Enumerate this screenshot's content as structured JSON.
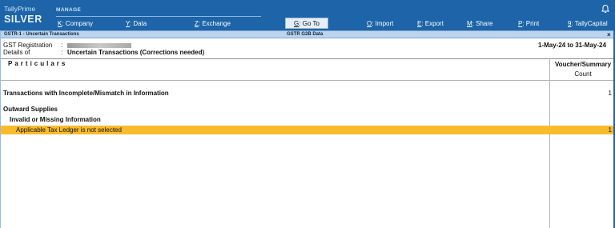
{
  "app": {
    "brand_line1": "TallyPrime",
    "brand_line2": "SILVER",
    "manage_label": "MANAGE"
  },
  "menu": [
    {
      "key": "K",
      "rest": ": Company"
    },
    {
      "key": "Y",
      "rest": ": Data"
    },
    {
      "key": "Z",
      "rest": ": Exchange"
    },
    {
      "key": "G",
      "rest": ": Go To"
    },
    {
      "key": "O",
      "rest": ": Import"
    },
    {
      "key": "E",
      "rest": ": Export"
    },
    {
      "key": "M",
      "rest": ": Share"
    },
    {
      "key": "P",
      "rest": ": Print"
    },
    {
      "key": "9",
      "rest": ": TallyCapital"
    }
  ],
  "titlebar": {
    "left": "GSTR-1 - Uncertain Transactions",
    "center": "GSTR G2B Data",
    "close": "×"
  },
  "info": {
    "gst_label": "GST Registration",
    "gst_colon": ":",
    "details_label": "Details of",
    "details_colon": ":",
    "details_value": "Uncertain Transactions (Corrections needed)",
    "period": "1-May-24 to 31-May-24"
  },
  "columns": {
    "particulars": "Particulars",
    "count_line1": "Voucher/Summary",
    "count_line2": "Count"
  },
  "rows": [
    {
      "label": "Transactions with Incomplete/Mismatch in Information",
      "count": "1"
    },
    {
      "label": "Outward Supplies",
      "count": ""
    },
    {
      "label": "Invalid or Missing Information",
      "count": ""
    },
    {
      "label": "Applicable Tax Ledger is not selected",
      "count": "1"
    }
  ],
  "colors": {
    "topbar": "#1d64a8",
    "titlebar": "#bcd4ee",
    "highlight": "#f7bb2b"
  },
  "icons": {
    "bell": "bell-icon"
  }
}
